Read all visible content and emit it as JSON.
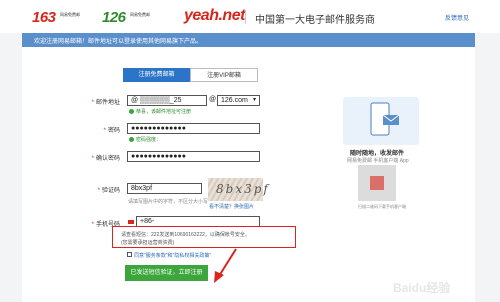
{
  "header": {
    "logo_163": "163",
    "logo_163_sub": "网易免费邮",
    "logo_126": "126",
    "logo_126_sub": "网易免费邮",
    "logo_yeah": "yeah.net",
    "slogan": "中国第一大电子邮件服务商",
    "feedback": "反馈意见"
  },
  "notice": "欢迎注册网易邮箱！邮件地址可以登录使用其他网易旗下产品。",
  "tabs": [
    {
      "label": "注册免费邮箱",
      "active": true
    },
    {
      "label": "注册VIP邮箱",
      "active": false
    }
  ],
  "form": {
    "email_label": "邮件地址",
    "email_value": "@ ▒▒▒▒▒▒_25",
    "email_domain": "@",
    "email_domain_select": "126.com",
    "email_hint": "恭喜，该邮件地址可注册",
    "password_label": "密码",
    "password_value": "●●●●●●●●●●●●●",
    "password_hint": "密码强度：",
    "confirm_label": "确认密码",
    "confirm_value": "●●●●●●●●●●●●●",
    "captcha_label": "验证码",
    "captcha_value": "8bx3pf",
    "captcha_hint": "请填写图片中的字符，不区分大小写",
    "captcha_image_text": "8bx3pf",
    "captcha_refresh": "看不清楚？换张图片",
    "phone_label": "手机号码",
    "phone_value": "+86-",
    "sms_note_1": "请查看短信：222发送到10690163222，以确保帐号安全。",
    "sms_note_2": "(您需要承担运营商资费)",
    "agree_text": "同意\"服务条款\"和\"隐私权相关政策\"",
    "submit_label": "已发送短信验证，立即注册"
  },
  "side": {
    "title": "随时随地，收发邮件",
    "subtitle": "网易免费邮 手机客户端 App",
    "qr_caption": "扫描二维码下载手机客户端"
  },
  "watermark": "Baidu经验",
  "colors": {
    "brand_blue": "#2b74c7",
    "notice_blue": "#5b8fcc",
    "submit_green": "#3ca53c",
    "highlight_red": "#d9261c"
  }
}
